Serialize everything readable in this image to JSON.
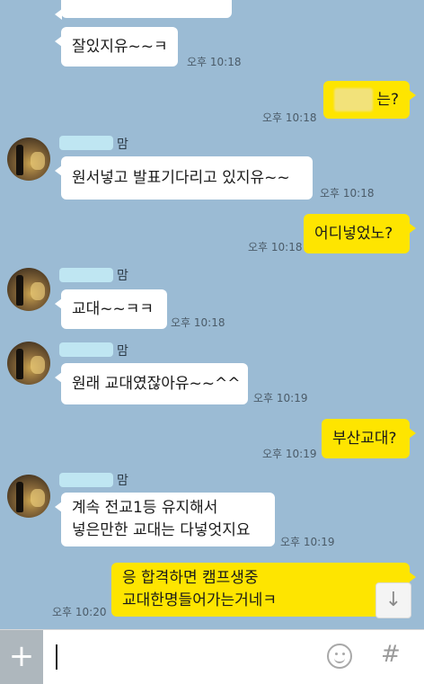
{
  "messages": [
    {
      "text": "잘있지유~~ㅋ",
      "time": "오후 10:18"
    },
    {
      "text": "는?",
      "time": "오후 10:18"
    },
    {
      "name_suffix": "맘",
      "text": "원서넣고 발표기다리고 있지유~~",
      "time": "오후 10:18"
    },
    {
      "text": "어디넣었노?",
      "time": "오후 10:18"
    },
    {
      "name_suffix": "맘",
      "text": "교대~~ㅋㅋ",
      "time": "오후 10:18"
    },
    {
      "name_suffix": "맘",
      "text": "원래 교대였잖아유~~^^",
      "time": "오후 10:19"
    },
    {
      "text": "부산교대?",
      "time": "오후 10:19"
    },
    {
      "name_suffix": "맘",
      "lines": [
        "계속 전교1등 유지해서",
        "넣은만한 교대는 다넣엇지요"
      ],
      "time": "오후 10:19"
    },
    {
      "lines": [
        "응 합격하면 캠프생중",
        "교대한명들어가는거네ㅋ"
      ],
      "time": "오후 10:20"
    }
  ],
  "input": {
    "plus": "+",
    "hash": "#",
    "scroll_down": "↓"
  },
  "colors": {
    "background": "#9bbbd4",
    "incoming_bubble": "#ffffff",
    "outgoing_bubble": "#fee500"
  },
  "icons": [
    "plus-icon",
    "emoji-icon",
    "hash-icon",
    "arrow-down-icon"
  ]
}
